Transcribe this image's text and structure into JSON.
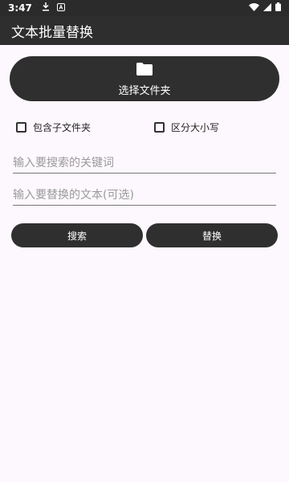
{
  "status_bar": {
    "time": "3:47",
    "icons": [
      "download-icon",
      "notification-app-icon",
      "wifi-icon",
      "signal-icon",
      "battery-icon"
    ]
  },
  "app_bar": {
    "title": "文本批量替换"
  },
  "folder_button": {
    "label": "选择文件夹",
    "icon": "folder-icon"
  },
  "options": {
    "include_subfolders": {
      "label": "包含子文件夹",
      "checked": false
    },
    "case_sensitive": {
      "label": "区分大小写",
      "checked": false
    }
  },
  "fields": {
    "search_placeholder": "输入要搜索的关键词",
    "replace_placeholder": "输入要替换的文本(可选)"
  },
  "buttons": {
    "search": "搜索",
    "replace": "替换"
  },
  "colors": {
    "app_bar": "#2e2e2e",
    "button": "#2f2f2f",
    "background": "#fdf8fd"
  }
}
